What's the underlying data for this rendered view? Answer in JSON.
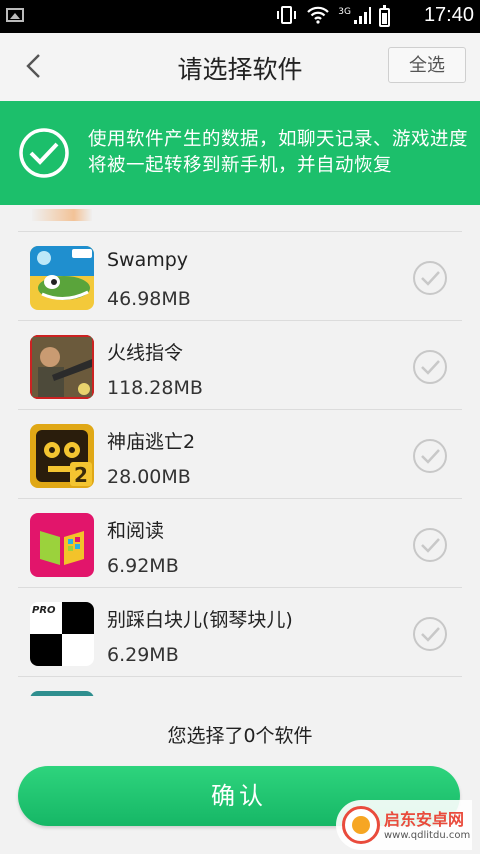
{
  "status_bar": {
    "time": "17:40",
    "network": "3G"
  },
  "header": {
    "title": "请选择软件",
    "select_all": "全选"
  },
  "banner": {
    "text": "使用软件产生的数据，如聊天记录、游戏进度将被一起转移到新手机，并自动恢复"
  },
  "apps": [
    {
      "name": "Swampy",
      "size": "46.98MB",
      "icon": "swampy-app-icon"
    },
    {
      "name": "火线指令",
      "size": "118.28MB",
      "icon": "fireline-app-icon"
    },
    {
      "name": "神庙逃亡2",
      "size": "28.00MB",
      "icon": "temple-run-2-app-icon"
    },
    {
      "name": "和阅读",
      "size": "6.92MB",
      "icon": "he-reading-app-icon"
    },
    {
      "name": "别踩白块儿(钢琴块儿)",
      "size": "6.29MB",
      "icon": "piano-tiles-app-icon"
    }
  ],
  "footer": {
    "selected_text": "您选择了0个软件",
    "confirm_label": "确认"
  },
  "watermark": {
    "title": "启东安卓网",
    "url": "www.qdlitdu.com"
  },
  "colors": {
    "accent": "#1cbf6b",
    "check_gray": "#c8c8c8"
  }
}
